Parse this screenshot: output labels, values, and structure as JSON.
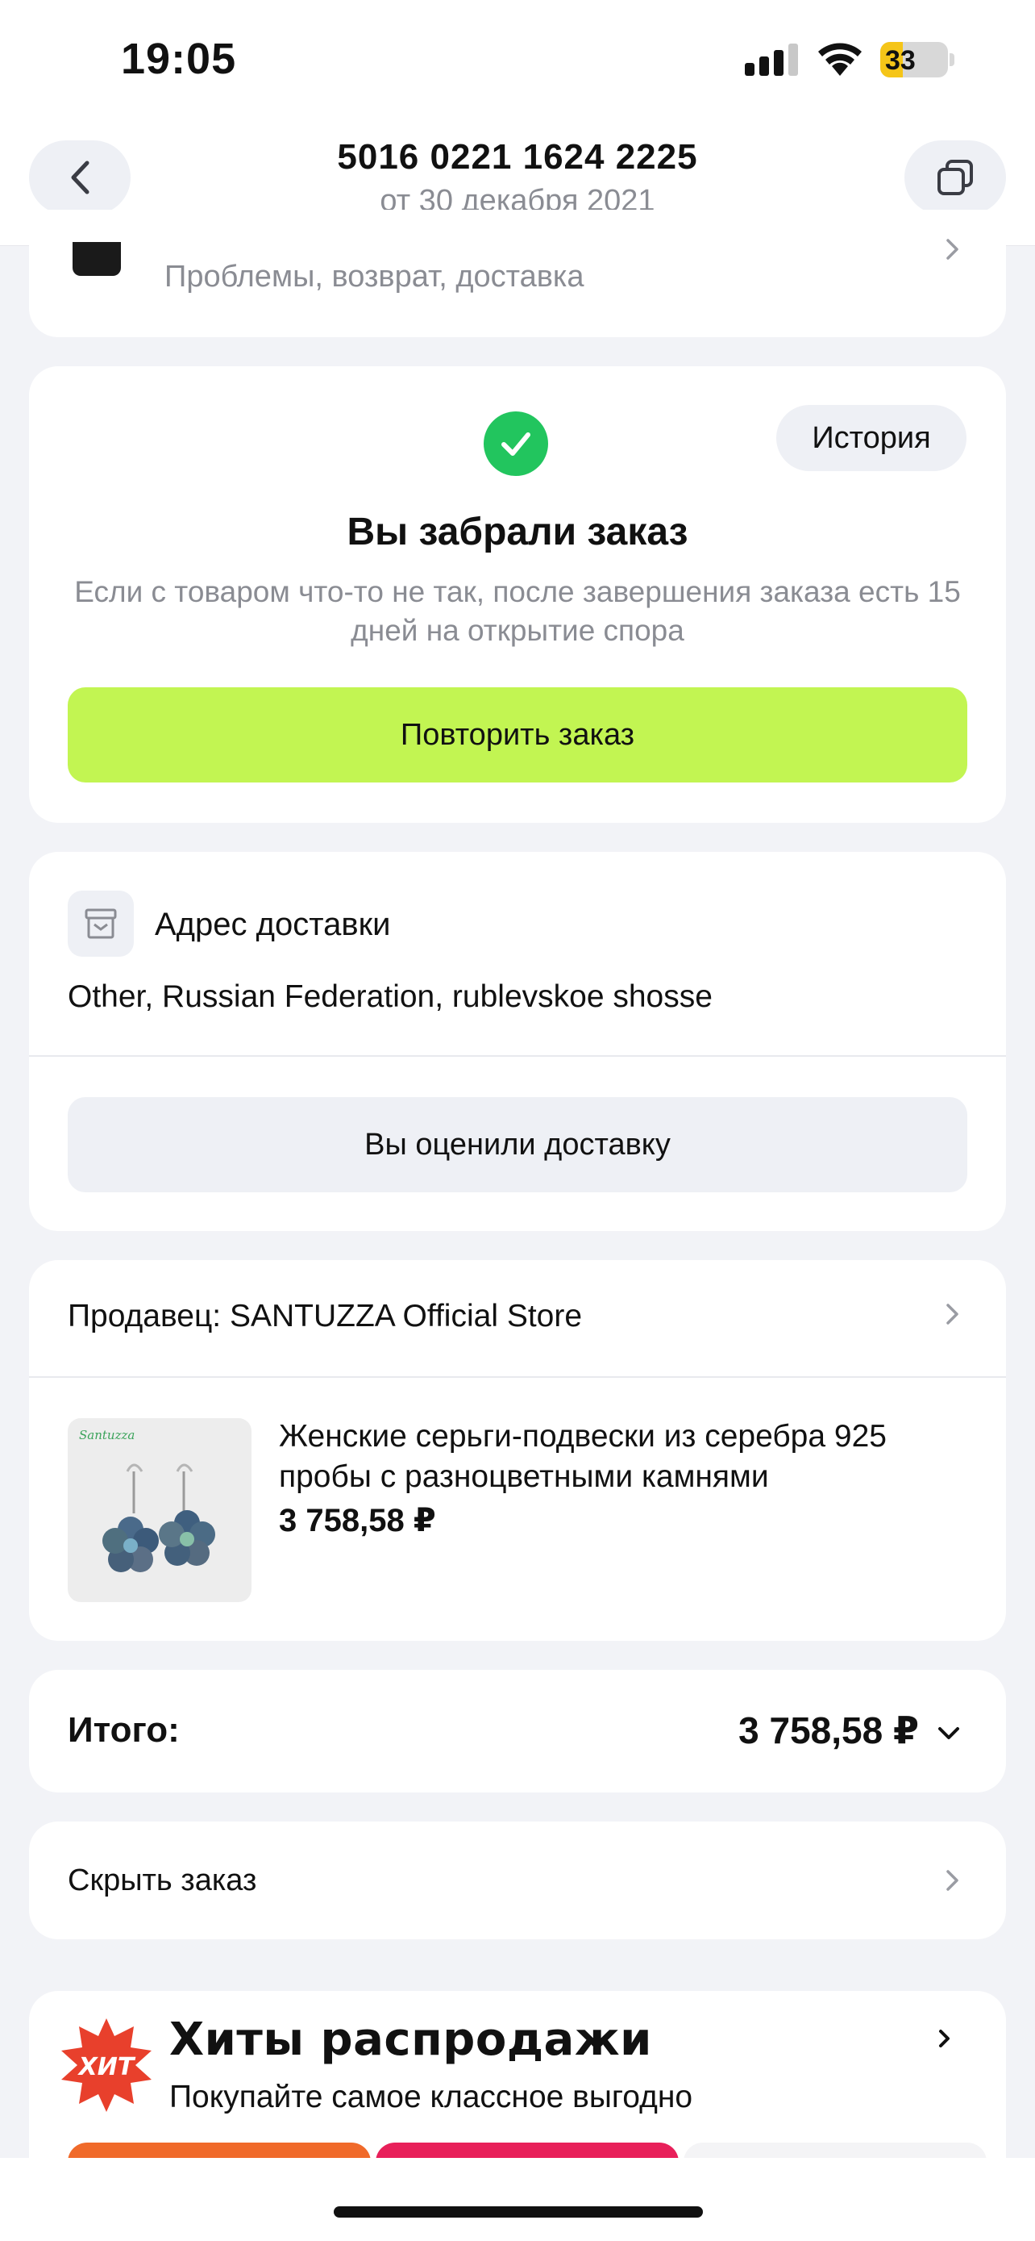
{
  "status_bar": {
    "time": "19:05",
    "battery": "33",
    "battery_level": 0.33
  },
  "header": {
    "order_number": "5016 0221 1624 2225",
    "order_date": "от 30 декабря 2021"
  },
  "support": {
    "subtitle": "Проблемы, возврат, доставка"
  },
  "order_status": {
    "history_label": "История",
    "title": "Вы забрали заказ",
    "description": "Если с товаром что-то не так, после завершения заказа есть 15 дней на открытие спора",
    "repeat_label": "Повторить заказ"
  },
  "delivery": {
    "label": "Адрес доставки",
    "address": "Other, Russian Federation, rublevskoe shosse",
    "rated_label": "Вы оценили доставку"
  },
  "seller": {
    "label": "Продавец: SANTUZZA Official Store",
    "product": {
      "title": "Женские серьги-подвески из серебра 925 пробы с разноцветными камнями",
      "price": "3 758,58 ₽",
      "thumb_brand": "Santuzza"
    }
  },
  "total": {
    "label": "Итого:",
    "value": "3 758,58 ₽"
  },
  "hide_order": {
    "label": "Скрыть заказ"
  },
  "hits": {
    "badge": "ХИТ",
    "title": "Хиты распродажи",
    "subtitle": "Покупайте самое классное выгодно"
  },
  "colors": {
    "accent_green": "#c2f552",
    "check_green": "#22c55e",
    "hit_red": "#e8402c",
    "background": "#f2f3f7"
  }
}
